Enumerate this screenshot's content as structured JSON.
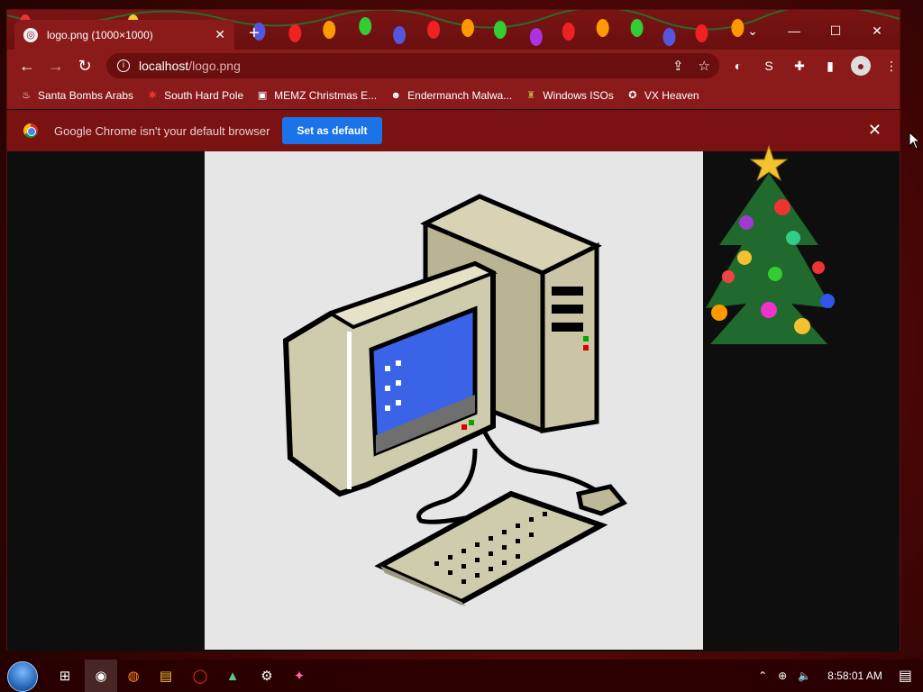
{
  "browser": {
    "tab": {
      "title": "logo.png (1000×1000)",
      "close_glyph": "✕"
    },
    "new_tab_glyph": "+",
    "window_controls": {
      "tabsearch": "⌄",
      "minimize": "—",
      "maximize": "☐",
      "close": "✕"
    },
    "nav": {
      "back": "←",
      "forward": "→",
      "reload": "↻"
    },
    "address": {
      "host": "localhost",
      "path": "/logo.png"
    },
    "omnibox_icons": {
      "share": "⇪",
      "bookmark": "☆"
    },
    "toolbar_icons": {
      "ext1": "◐",
      "ext2": "S",
      "extensions": "✚",
      "sidepanel": "▮",
      "profile": "●",
      "menu": "⋮"
    },
    "bookmarks": [
      {
        "label": "Santa Bombs Arabs",
        "icon": "♨"
      },
      {
        "label": "South Hard Pole",
        "icon": "✱"
      },
      {
        "label": "MEMZ Christmas E...",
        "icon": "▣"
      },
      {
        "label": "Endermanch Malwa...",
        "icon": "☻"
      },
      {
        "label": "Windows ISOs",
        "icon": "♜"
      },
      {
        "label": "VX Heaven",
        "icon": "✪"
      }
    ],
    "infobar": {
      "message": "Google Chrome isn't your default browser",
      "button": "Set as default",
      "close": "✕"
    }
  },
  "taskbar": {
    "icons": [
      "⊞",
      "◉",
      "◍",
      "▤",
      "◯",
      "▲",
      "⚙",
      "✦"
    ],
    "tray": {
      "chevron": "⌃",
      "network": "⊕",
      "volume": "🔈",
      "time": "8:58:01 AM",
      "notifications": "▤"
    }
  },
  "colors": {
    "chrome_red": "#8b1a1a",
    "accent_blue": "#1a73e8",
    "screen_blue": "#3a63e8"
  }
}
